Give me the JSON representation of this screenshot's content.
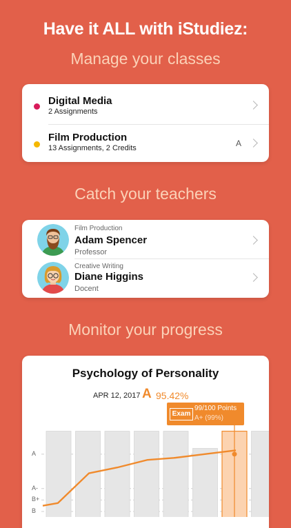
{
  "headline": "Have it ALL with iStudiez:",
  "sections": {
    "classes_title": "Manage your classes",
    "teachers_title": "Catch your teachers",
    "progress_title": "Monitor your progress"
  },
  "classes": [
    {
      "name": "Digital Media",
      "detail": "2 Assignments",
      "color": "#d81b5a",
      "grade": ""
    },
    {
      "name": "Film Production",
      "detail": "13 Assignments, 2 Credits",
      "color": "#f5b800",
      "grade": "A"
    }
  ],
  "teachers": [
    {
      "course": "Film Production",
      "name": "Adam Spencer",
      "role": "Professor",
      "avatar": "bearded-man-avatar"
    },
    {
      "course": "Creative Writing",
      "name": "Diane Higgins",
      "role": "Docent",
      "avatar": "woman-with-glasses-avatar"
    }
  ],
  "progress": {
    "course_title": "Psychology of Personality",
    "date": "APR 12, 2017",
    "grade": "A",
    "percent": "95.42%",
    "tooltip": {
      "kind": "Exam",
      "points": "99/100 Points",
      "grade": "A+ (99%)"
    },
    "accent": "#f08a2c"
  },
  "chart_data": {
    "type": "line",
    "y_labels": [
      "A",
      "A-",
      "B+",
      "B"
    ],
    "line_values": [
      79.5,
      80.2,
      88.0,
      89.5,
      91.5,
      92.0,
      93.0,
      94.0
    ],
    "bar_values": [
      99,
      99,
      99,
      99,
      99,
      94.5,
      99,
      99
    ],
    "highlighted_index": 6,
    "ylim": [
      78,
      100
    ],
    "grid": true
  }
}
